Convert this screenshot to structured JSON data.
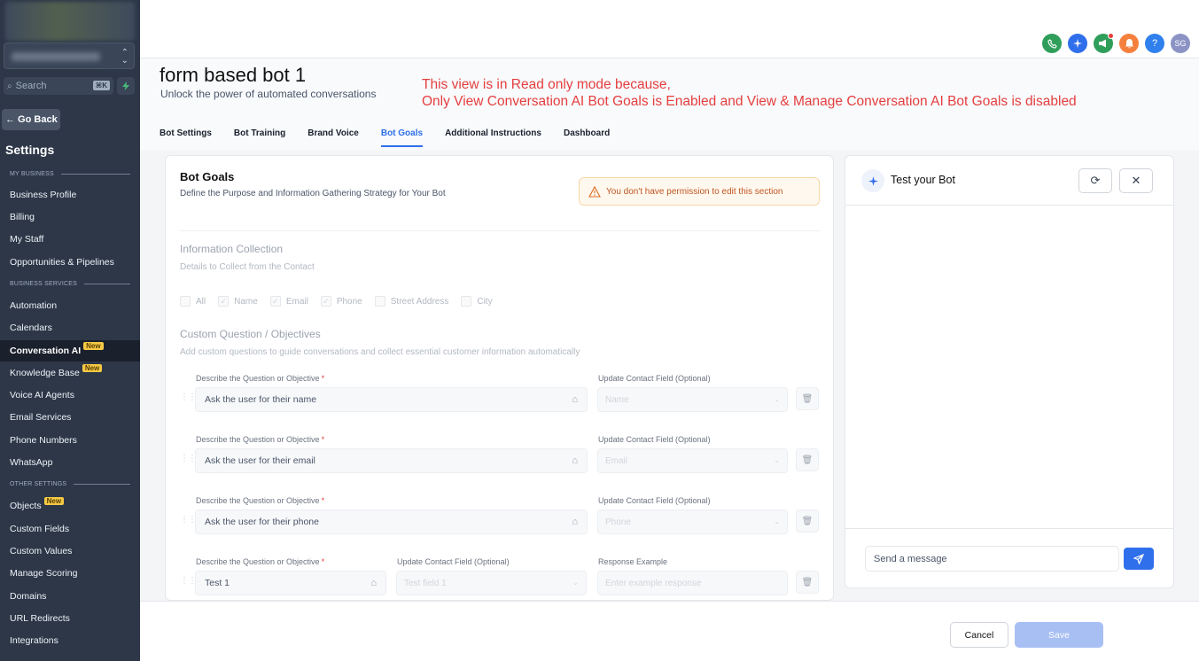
{
  "sidebar": {
    "search_placeholder": "Search",
    "search_shortcut": "⌘K",
    "back_label": "← Go Back",
    "title": "Settings",
    "sections": {
      "my_business": "MY BUSINESS",
      "business_services": "BUSINESS SERVICES",
      "other_settings": "OTHER SETTINGS"
    },
    "items": [
      {
        "label": "Business Profile"
      },
      {
        "label": "Billing"
      },
      {
        "label": "My Staff"
      },
      {
        "label": "Opportunities & Pipelines"
      },
      {
        "label": "Automation"
      },
      {
        "label": "Calendars"
      },
      {
        "label": "Conversation AI",
        "badge": "New",
        "active": true
      },
      {
        "label": "Knowledge Base",
        "badge": "New"
      },
      {
        "label": "Voice AI Agents"
      },
      {
        "label": "Email Services"
      },
      {
        "label": "Phone Numbers"
      },
      {
        "label": "WhatsApp"
      },
      {
        "label": "Objects",
        "badge": "New"
      },
      {
        "label": "Custom Fields"
      },
      {
        "label": "Custom Values"
      },
      {
        "label": "Manage Scoring"
      },
      {
        "label": "Domains"
      },
      {
        "label": "URL Redirects"
      },
      {
        "label": "Integrations"
      }
    ]
  },
  "header": {
    "avatar_initials": "SG",
    "icons": [
      "phone-icon",
      "ai-sparkle-icon",
      "megaphone-icon",
      "bell-icon",
      "help-icon"
    ],
    "icon_colors": [
      "#2f9e5b",
      "#2f6feb",
      "#2f9e5b",
      "#f5803e",
      "#2f80ed"
    ]
  },
  "page": {
    "title": "form based bot 1",
    "subtitle": "Unlock the power of automated conversations",
    "readonly_line1": "This view is in Read only mode because,",
    "readonly_line2": "Only View Conversation AI Bot Goals is Enabled and View & Manage Conversation AI Bot Goals is disabled",
    "tabs": [
      "Bot Settings",
      "Bot Training",
      "Brand Voice",
      "Bot Goals",
      "Additional Instructions",
      "Dashboard"
    ],
    "active_tab": "Bot Goals"
  },
  "goals": {
    "title": "Bot Goals",
    "subtitle": "Define the Purpose and Information Gathering Strategy for Your Bot",
    "permission_warning": "You don't have permission to edit this section",
    "info_title": "Information Collection",
    "info_sub": "Details to Collect from the Contact",
    "checkboxes": [
      {
        "label": "All",
        "checked": false
      },
      {
        "label": "Name",
        "checked": true
      },
      {
        "label": "Email",
        "checked": true
      },
      {
        "label": "Phone",
        "checked": true
      },
      {
        "label": "Street Address",
        "checked": false
      },
      {
        "label": "City",
        "checked": false
      }
    ],
    "custom_title": "Custom Question / Objectives",
    "custom_sub": "Add custom questions to guide conversations and collect essential customer information automatically",
    "question_label": "Describe the Question or Objective",
    "required_mark": "*",
    "field_label": "Update Contact Field (Optional)",
    "response_label": "Response Example",
    "questions": [
      {
        "text": "Ask the user for their name",
        "field": "Name"
      },
      {
        "text": "Ask the user for their email",
        "field": "Email"
      },
      {
        "text": "Ask the user for their phone",
        "field": "Phone"
      },
      {
        "text": "Test 1",
        "field": "Test field 1",
        "response_placeholder": "Enter example response"
      }
    ]
  },
  "bot_panel": {
    "title": "Test your Bot",
    "message_placeholder": "Send a message"
  },
  "footer": {
    "cancel": "Cancel",
    "save": "Save"
  }
}
